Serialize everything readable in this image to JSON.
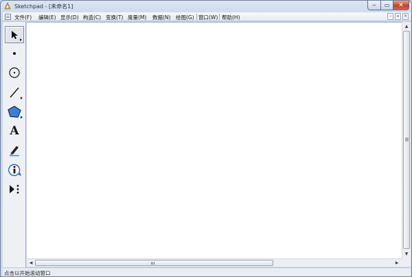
{
  "window": {
    "title": "Sketchpad  - [未命名1]",
    "controls": {
      "minimize": "‒",
      "maximize": "▭",
      "close": "✕"
    }
  },
  "menubar": {
    "items": [
      "文件(F)",
      "编辑(E)",
      "显示(D)",
      "构造(C)",
      "变换(T)",
      "度量(M)",
      "数据(N)",
      "绘图(G)",
      "窗口(W)",
      "帮助(H)"
    ],
    "mdi_controls": {
      "minimize": "–",
      "restore": "▫",
      "close": "×"
    }
  },
  "toolbox": {
    "tools": [
      {
        "name": "arrow-select-icon",
        "active": true
      },
      {
        "name": "point-icon"
      },
      {
        "name": "compass-circle-icon"
      },
      {
        "name": "straightedge-line-icon"
      },
      {
        "name": "polygon-icon"
      },
      {
        "name": "text-icon",
        "label": "A"
      },
      {
        "name": "marker-pen-icon"
      },
      {
        "name": "information-icon"
      },
      {
        "name": "custom-tool-icon"
      }
    ]
  },
  "scrollbars": {
    "vertical_thumb_fraction": 0.97,
    "horizontal_thumb_fraction": 0.66
  },
  "statusbar": {
    "text": "点击以开始滚动窗口"
  },
  "colors": {
    "accent": "#3a6fc4",
    "close_button": "#c4422b",
    "polygon_fill": "#3e7fd3"
  }
}
